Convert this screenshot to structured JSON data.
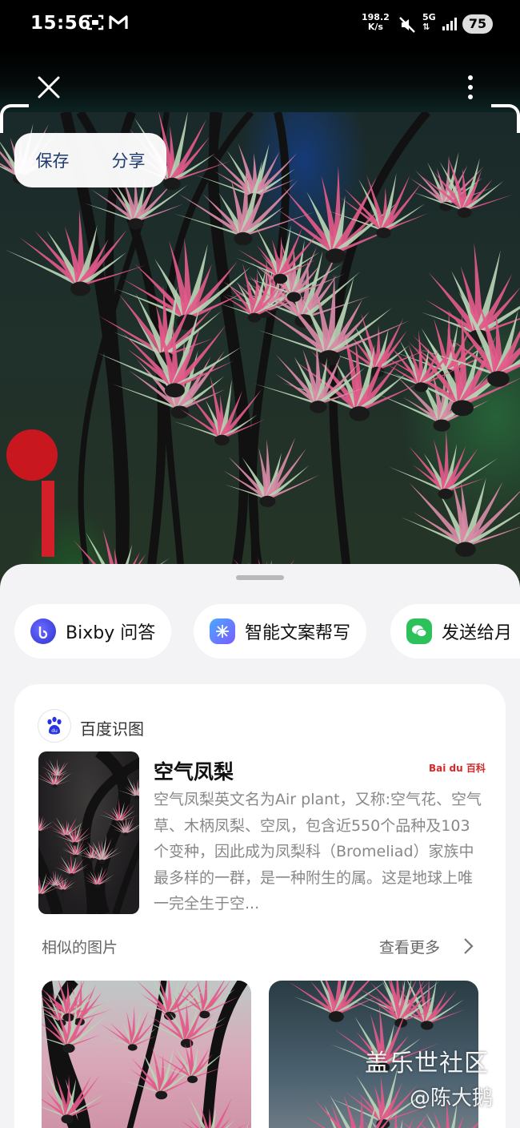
{
  "status_bar": {
    "time": "15:56",
    "net_speed_value": "198.2",
    "net_speed_unit": "K/s",
    "network": "5G",
    "battery": "75"
  },
  "toolbar": {
    "close_icon": "close-icon",
    "more_icon": "more-vertical-icon"
  },
  "image_actions": {
    "save_label": "保存",
    "share_label": "分享"
  },
  "chips": [
    {
      "label": "Bixby 问答",
      "icon": "bixby-icon"
    },
    {
      "label": "智能文案帮写",
      "icon": "ai-writing-icon"
    },
    {
      "label": "发送给月",
      "icon": "wechat-icon"
    }
  ],
  "result_card": {
    "source": "百度识图",
    "title": "空气凤梨",
    "baike_brand": "Bai du 百科",
    "description": "空气凤梨英文名为Air plant，又称:空气花、空气草、木柄凤梨、空凤，包含近550个品种及103个变种，因此成为凤梨科（Bromeliad）家族中最多样的一群，是一种附生的属。这是地球上唯一完全生于空...",
    "similar_label": "相似的图片",
    "see_more_label": "查看更多"
  },
  "watermark": {
    "line1": "盖乐世社区",
    "line2": "@陈大鹅"
  },
  "colors": {
    "sheet_bg": "#f3f3f5",
    "card_bg": "#ffffff",
    "save_share_text": "#1f3a6e",
    "baidu_blue": "#2932e1",
    "baike_red": "#d62828"
  }
}
